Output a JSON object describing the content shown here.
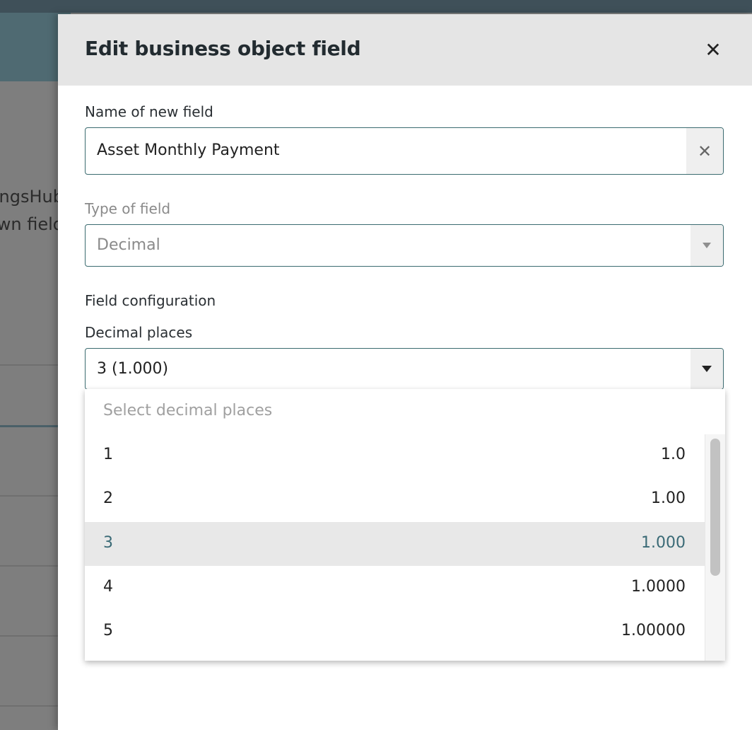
{
  "background": {
    "text_line_1": "ThingsHub",
    "text_line_2": "own field"
  },
  "modal": {
    "title": "Edit business object field",
    "close_icon": "close-icon"
  },
  "form": {
    "name_label": "Name of new field",
    "name_value": "Asset Monthly Payment",
    "type_label": "Type of field",
    "type_value": "Decimal",
    "config_label": "Field configuration",
    "decimal_label": "Decimal places",
    "decimal_value": "3 (1.000)"
  },
  "dropdown": {
    "placeholder": "Select decimal places",
    "selected_index": 2,
    "options": [
      {
        "places": "1",
        "example": "1.0"
      },
      {
        "places": "2",
        "example": "1.00"
      },
      {
        "places": "3",
        "example": "1.000"
      },
      {
        "places": "4",
        "example": "1.0000"
      },
      {
        "places": "5",
        "example": "1.00000"
      }
    ]
  },
  "colors": {
    "accent": "#3b6b70",
    "selected_text": "#3a6a76",
    "header_bg": "#e5e5e5"
  }
}
